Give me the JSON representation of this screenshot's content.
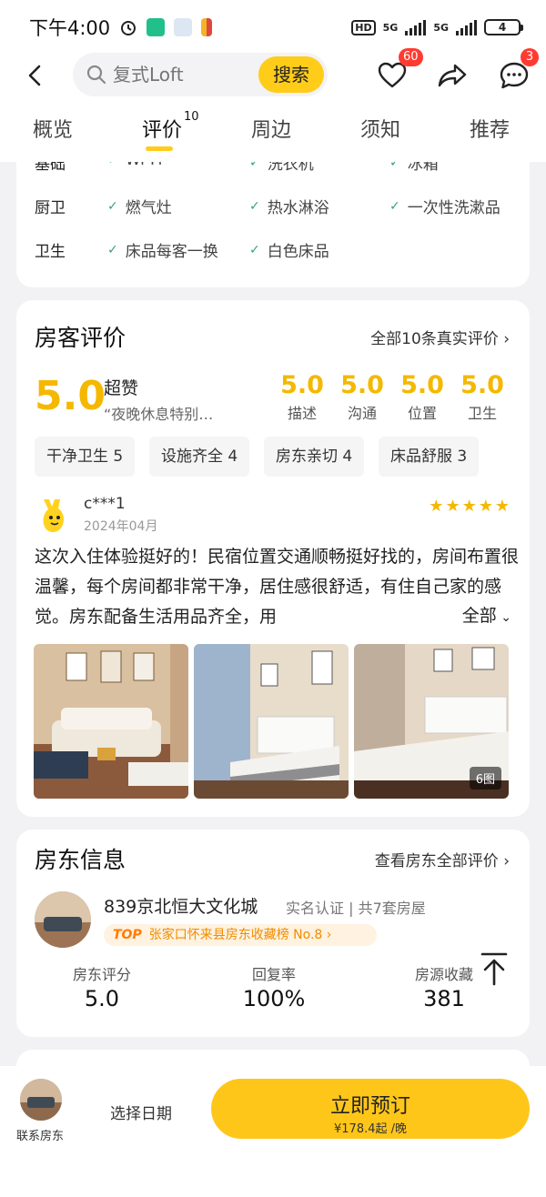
{
  "status_bar": {
    "time": "下午4:00",
    "battery": "4",
    "hd": "HD",
    "net1": "5G",
    "net2": "5G"
  },
  "header": {
    "search_placeholder": "复式Loft",
    "search_button": "搜索",
    "favorites_badge": "60",
    "messages_badge": "3"
  },
  "tabs": [
    {
      "label": "概览"
    },
    {
      "label": "评价",
      "count": "10"
    },
    {
      "label": "周边"
    },
    {
      "label": "须知"
    },
    {
      "label": "推荐"
    }
  ],
  "facilities": {
    "rows": [
      {
        "category": "基础",
        "items": [
          "Wi-Fi",
          "洗衣机",
          "冰箱"
        ]
      },
      {
        "category": "厨卫",
        "items": [
          "燃气灶",
          "热水淋浴",
          "一次性洗漱品"
        ]
      },
      {
        "category": "卫生",
        "items": [
          "床品每客一换",
          "白色床品"
        ]
      }
    ]
  },
  "reviews": {
    "title": "房客评价",
    "all_link": "全部10条真实评价",
    "overall_score": "5.0",
    "rating_word": "超赞",
    "quote": "“夜晚休息特别…",
    "sub_scores": [
      {
        "value": "5.0",
        "label": "描述"
      },
      {
        "value": "5.0",
        "label": "沟通"
      },
      {
        "value": "5.0",
        "label": "位置"
      },
      {
        "value": "5.0",
        "label": "卫生"
      }
    ],
    "tags": [
      "干净卫生 5",
      "设施齐全 4",
      "房东亲切 4",
      "床品舒服 3"
    ],
    "review": {
      "user": "c***1",
      "date": "2024年04月",
      "stars": 5,
      "text": "这次入住体验挺好的！民宿位置交通顺畅挺好找的，房间布置很温馨，每个房间都非常干净，居住感很舒适，有住自己家的感觉。房东配备生活用品齐全，用",
      "more": "全部",
      "photo_count": "6图"
    }
  },
  "host": {
    "title": "房东信息",
    "link": "查看房东全部评价",
    "name": "839京北恒大文化城",
    "meta": "实名认证 | 共7套房屋",
    "top_label": "TOP",
    "ranking": "张家口怀来县房东收藏榜 No.8",
    "stats": [
      {
        "label": "房东评分",
        "value": "5.0"
      },
      {
        "label": "回复率",
        "value": "100%"
      },
      {
        "label": "房源收藏",
        "value": "381"
      }
    ]
  },
  "bottom_bar": {
    "contact": "联系房东",
    "pick_date": "选择日期",
    "book": "立即预订",
    "price": "¥178.4起 /晚"
  },
  "colors": {
    "accent": "#ffcc1a",
    "score": "#f5b800",
    "check": "#3aa17e",
    "badge": "#ff3b30"
  }
}
